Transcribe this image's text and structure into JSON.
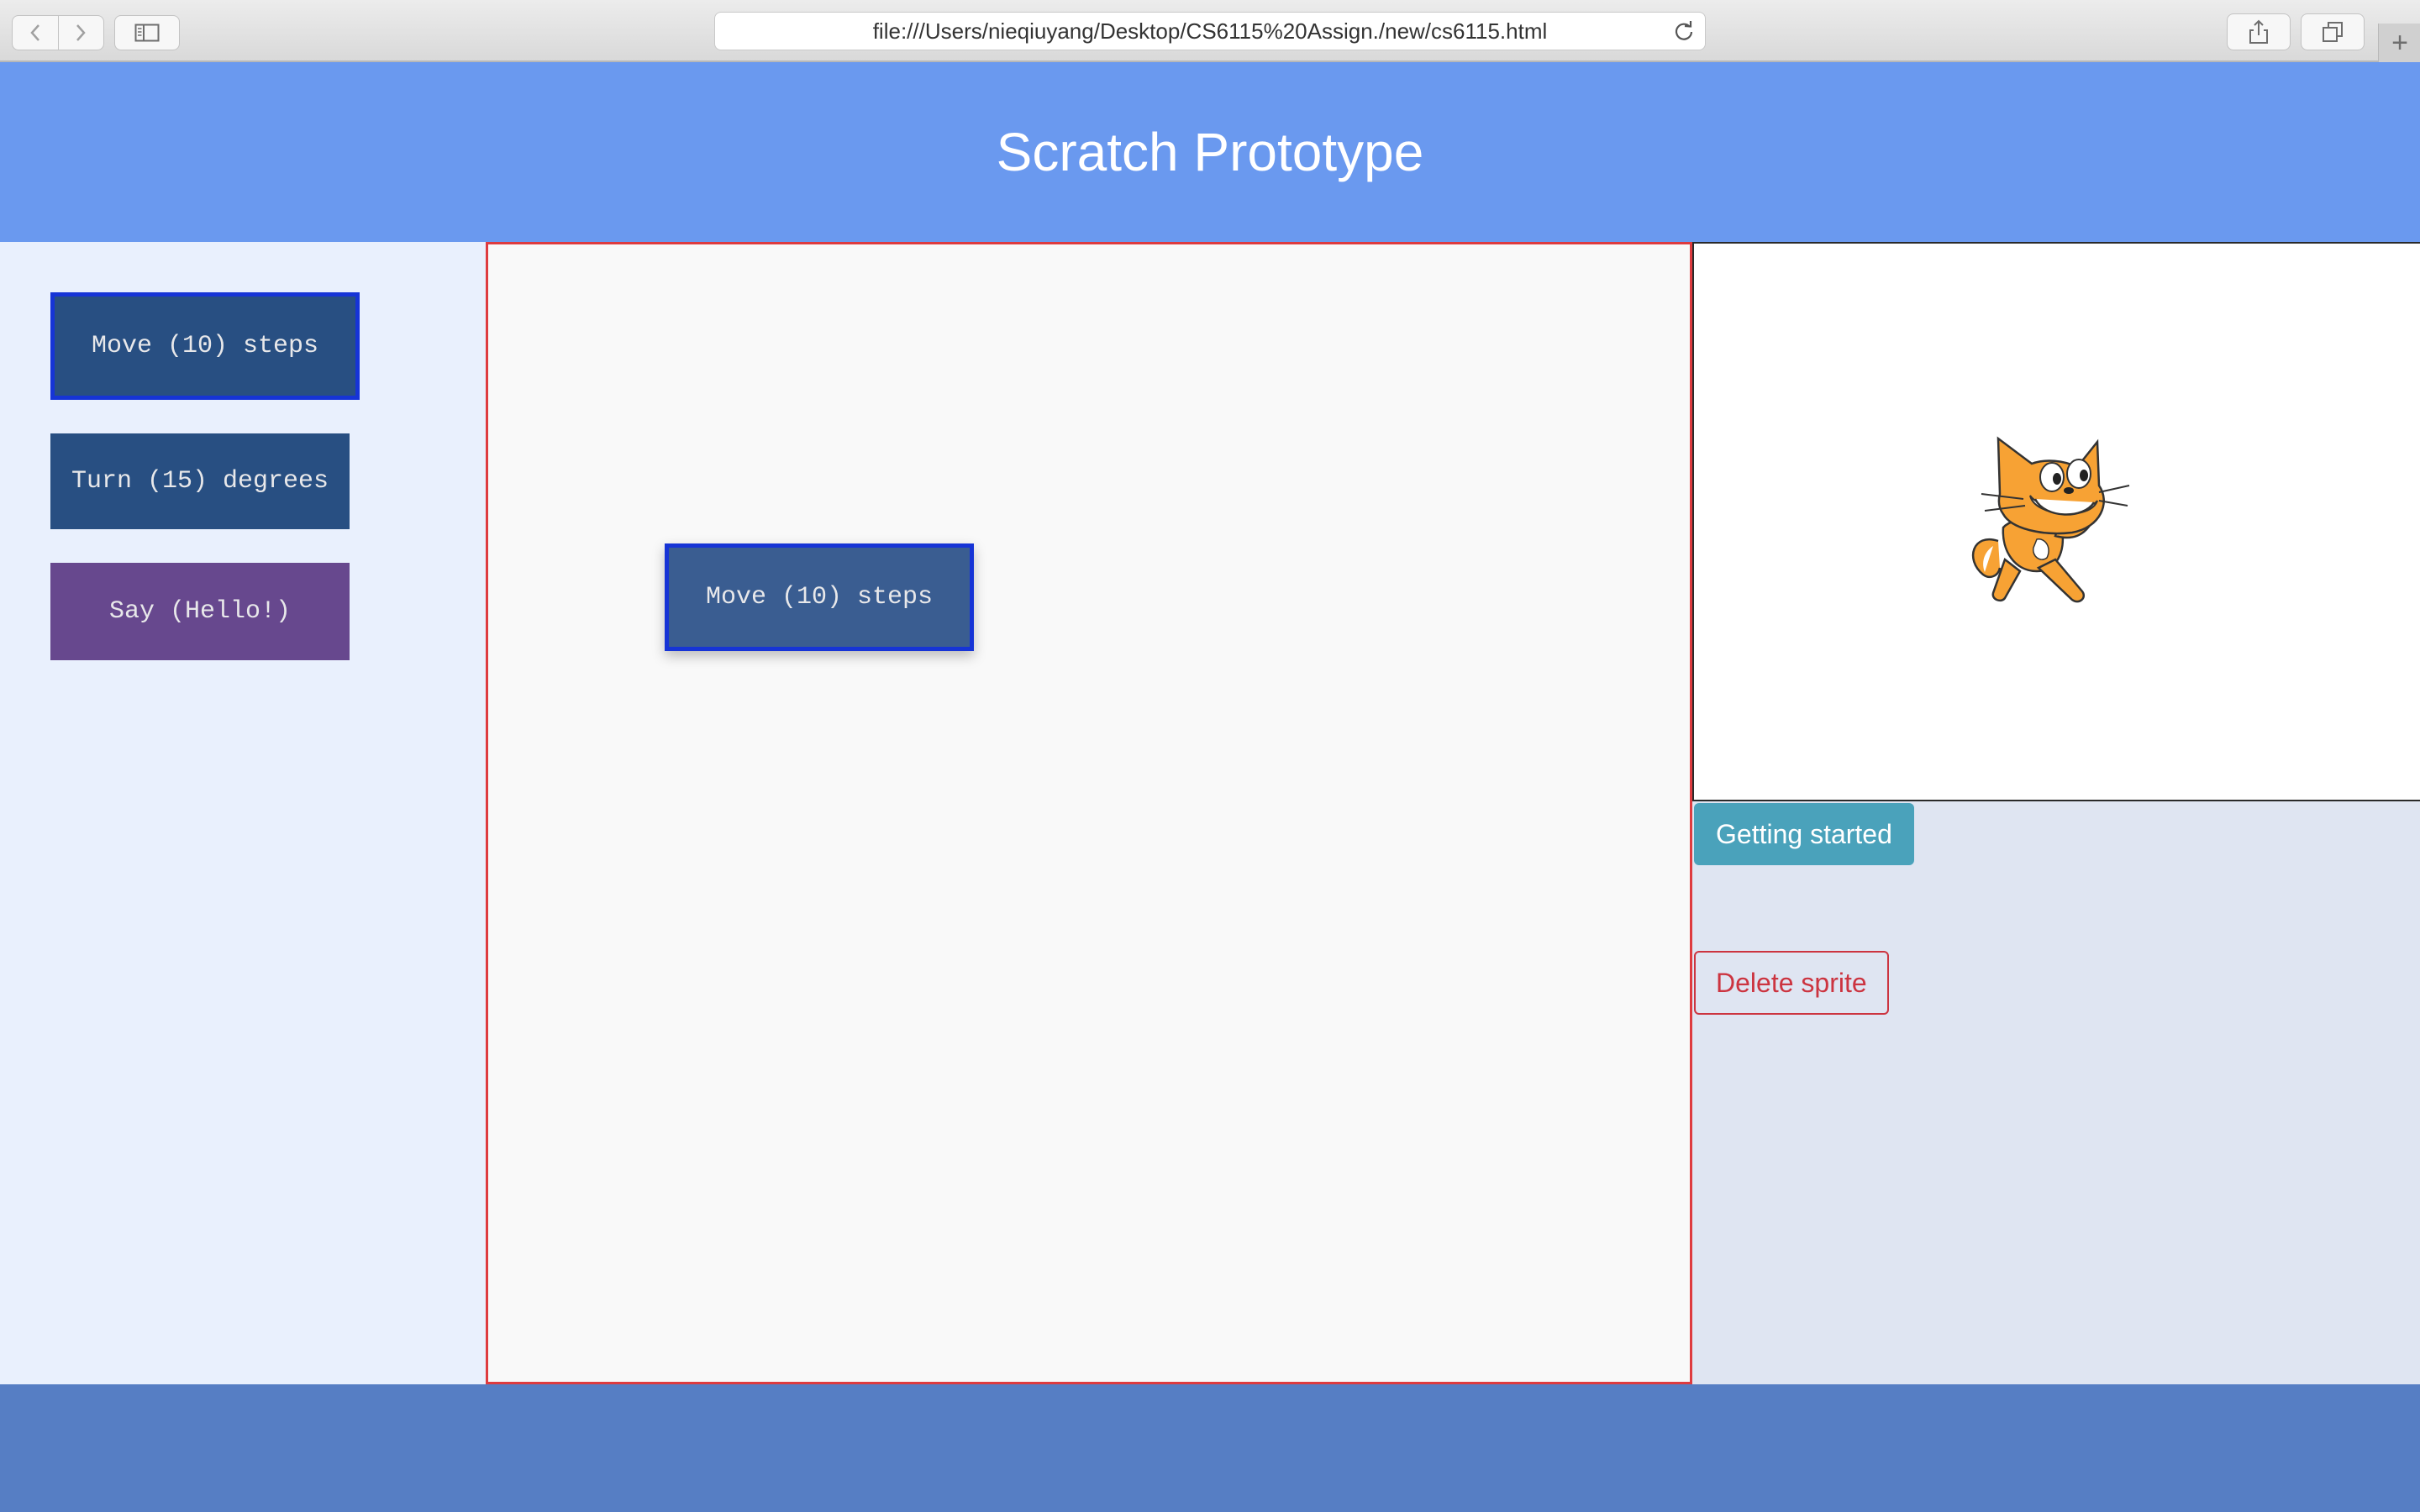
{
  "browser": {
    "url": "file:///Users/nieqiuyang/Desktop/CS6115%20Assign./new/cs6115.html",
    "icons": [
      "back-icon",
      "forward-icon",
      "sidebar-icon",
      "reload-icon",
      "share-icon",
      "tabs-icon",
      "plus-icon"
    ],
    "new_tab_glyph": "+"
  },
  "header": {
    "title": "Scratch Prototype",
    "background": "#6a99ef"
  },
  "palette": {
    "blocks": [
      {
        "label": "Move (10) steps",
        "category": "motion",
        "selected": true
      },
      {
        "label": "Turn (15) degrees",
        "category": "motion",
        "selected": false
      },
      {
        "label": "Say (Hello!)",
        "category": "looks",
        "selected": false
      }
    ]
  },
  "script_area": {
    "border_color": "#de3b3f",
    "blocks": [
      {
        "label": "Move (10) steps"
      }
    ]
  },
  "stage": {
    "sprite": "scratch-cat"
  },
  "controls": {
    "getting_started": "Getting started",
    "delete_sprite": "Delete sprite"
  },
  "colors": {
    "motion_block": "#284f82",
    "looks_block": "#67488e",
    "selected_border": "#1634d6",
    "info_button": "#4aa2bb",
    "danger": "#cc3440",
    "footer": "#567ec4"
  }
}
